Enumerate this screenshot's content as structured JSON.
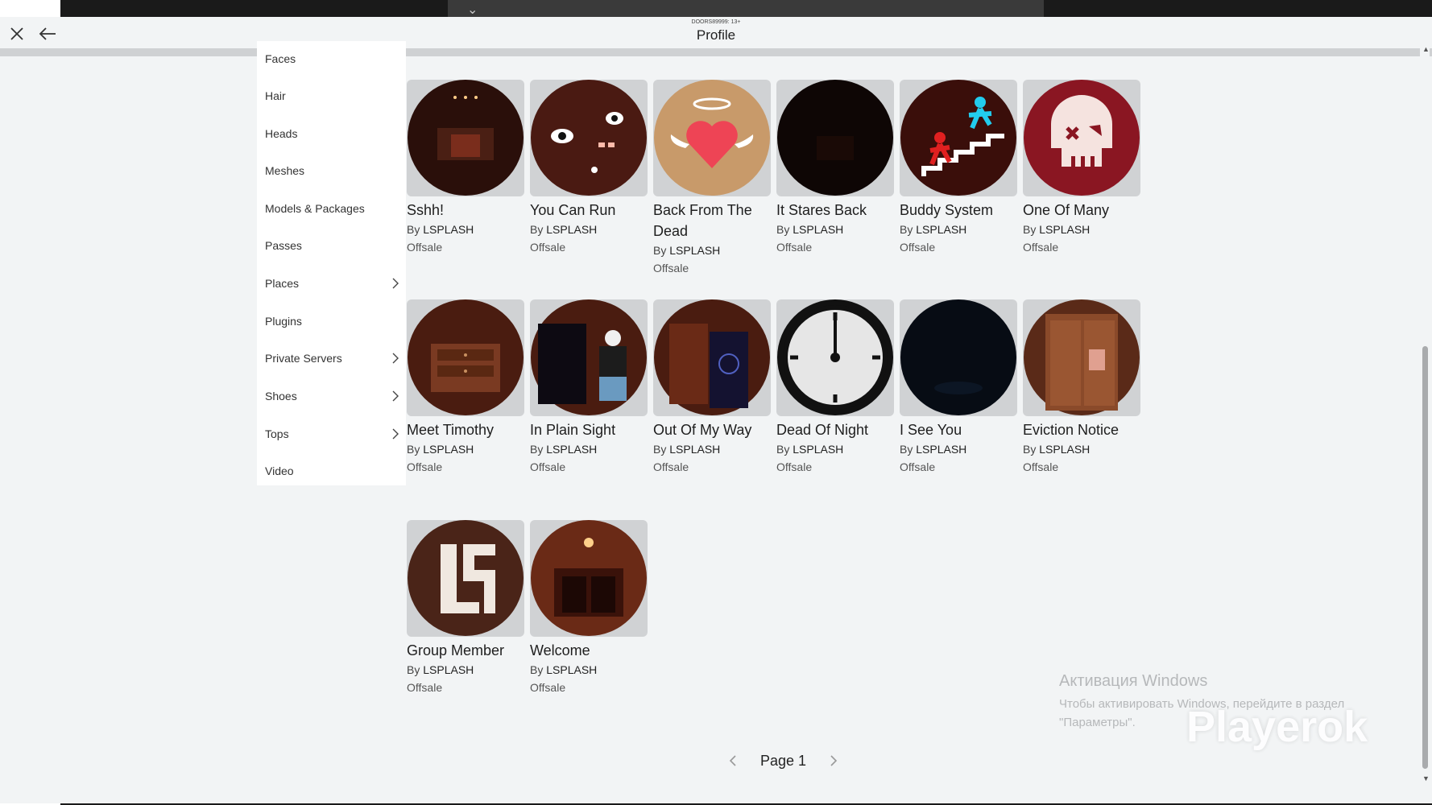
{
  "window": {
    "subtitle": "DOORS89999: 13+",
    "title": "Profile"
  },
  "sidebar": {
    "items": [
      {
        "label": "Faces",
        "has_chevron": false
      },
      {
        "label": "Hair",
        "has_chevron": false
      },
      {
        "label": "Heads",
        "has_chevron": false
      },
      {
        "label": "Meshes",
        "has_chevron": false
      },
      {
        "label": "Models & Packages",
        "has_chevron": false
      },
      {
        "label": "Passes",
        "has_chevron": false
      },
      {
        "label": "Places",
        "has_chevron": true
      },
      {
        "label": "Plugins",
        "has_chevron": false
      },
      {
        "label": "Private Servers",
        "has_chevron": true
      },
      {
        "label": "Shoes",
        "has_chevron": true
      },
      {
        "label": "Tops",
        "has_chevron": true
      },
      {
        "label": "Video",
        "has_chevron": false
      }
    ]
  },
  "items": [
    {
      "name": "Sshh!",
      "by_prefix": "By",
      "creator": "LSPLASH",
      "status": "Offsale",
      "icon": "dark-hallway"
    },
    {
      "name": "You Can Run",
      "by_prefix": "By",
      "creator": "LSPLASH",
      "status": "Offsale",
      "icon": "wall-eyes"
    },
    {
      "name": "Back From The Dead",
      "by_prefix": "By",
      "creator": "LSPLASH",
      "status": "Offsale",
      "icon": "winged-heart"
    },
    {
      "name": "It Stares Back",
      "by_prefix": "By",
      "creator": "LSPLASH",
      "status": "Offsale",
      "icon": "dark-room"
    },
    {
      "name": "Buddy System",
      "by_prefix": "By",
      "creator": "LSPLASH",
      "status": "Offsale",
      "icon": "stairs-figures"
    },
    {
      "name": "One Of Many",
      "by_prefix": "By",
      "creator": "LSPLASH",
      "status": "Offsale",
      "icon": "skull"
    },
    {
      "name": "Meet Timothy",
      "by_prefix": "By",
      "creator": "LSPLASH",
      "status": "Offsale",
      "icon": "dresser"
    },
    {
      "name": "In Plain Sight",
      "by_prefix": "By",
      "creator": "LSPLASH",
      "status": "Offsale",
      "icon": "closet-avatar"
    },
    {
      "name": "Out Of My Way",
      "by_prefix": "By",
      "creator": "LSPLASH",
      "status": "Offsale",
      "icon": "doorway-face"
    },
    {
      "name": "Dead Of Night",
      "by_prefix": "By",
      "creator": "LSPLASH",
      "status": "Offsale",
      "icon": "clock"
    },
    {
      "name": "I See You",
      "by_prefix": "By",
      "creator": "LSPLASH",
      "status": "Offsale",
      "icon": "dark-eyes"
    },
    {
      "name": "Eviction Notice",
      "by_prefix": "By",
      "creator": "LSPLASH",
      "status": "Offsale",
      "icon": "door-notice"
    },
    {
      "name": "Group Member",
      "by_prefix": "By",
      "creator": "LSPLASH",
      "status": "Offsale",
      "icon": "ls-logo"
    },
    {
      "name": "Welcome",
      "by_prefix": "By",
      "creator": "LSPLASH",
      "status": "Offsale",
      "icon": "lobby"
    }
  ],
  "pagination": {
    "page_label": "Page 1"
  },
  "watermark": {
    "windows_title": "Активация Windows",
    "windows_line1": "Чтобы активировать Windows, перейдите в раздел",
    "windows_line2": "\"Параметры\".",
    "brand": "Playerok"
  },
  "colors": {
    "background": "#f2f4f5",
    "sidebar": "#ffffff",
    "thumb_bg": "#d0d2d4"
  }
}
